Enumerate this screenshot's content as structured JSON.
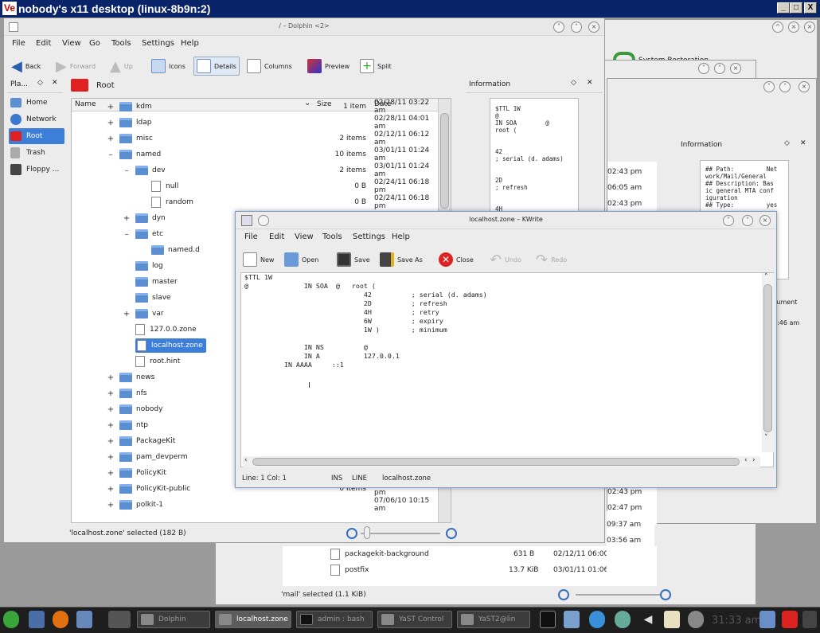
{
  "vnc": {
    "logo": "Ve",
    "title": "nobody's x11 desktop (linux-8b9n:2)",
    "min": "_",
    "max": "□",
    "close": "X"
  },
  "dolphin": {
    "title": "/ – Dolphin <2>",
    "menu": [
      "File",
      "Edit",
      "View",
      "Go",
      "Tools",
      "Settings",
      "Help"
    ],
    "toolbar": {
      "back": "Back",
      "forward": "Forward",
      "up": "Up",
      "icons": "Icons",
      "details": "Details",
      "columns": "Columns",
      "preview": "Preview",
      "split": "Split"
    },
    "places": {
      "title": "Pla...",
      "items": [
        "Home",
        "Network",
        "Root",
        "Trash",
        "Floppy ..."
      ]
    },
    "location": "Root",
    "columns": {
      "name": "Name",
      "size": "Size",
      "date": "Date"
    },
    "rows": [
      {
        "name": "kdm",
        "size": "1 item",
        "date": "02/28/11 03:22 am"
      },
      {
        "name": "ldap",
        "size": "",
        "date": "02/28/11 04:01 am"
      },
      {
        "name": "misc",
        "size": "2 items",
        "date": "02/12/11 06:12 am"
      },
      {
        "name": "named",
        "size": "10 items",
        "date": "03/01/11 01:24 am"
      },
      {
        "name": "dev",
        "size": "2 items",
        "date": "03/01/11 01:24 am"
      },
      {
        "name": "null",
        "size": "0 B",
        "date": "02/24/11 06:18 pm"
      },
      {
        "name": "random",
        "size": "0 B",
        "date": "02/24/11 06:18 pm"
      },
      {
        "name": "dyn",
        "size": "",
        "date": ""
      },
      {
        "name": "etc",
        "size": "",
        "date": ""
      },
      {
        "name": "named.d",
        "size": "",
        "date": ""
      },
      {
        "name": "log",
        "size": "",
        "date": ""
      },
      {
        "name": "master",
        "size": "",
        "date": ""
      },
      {
        "name": "slave",
        "size": "",
        "date": ""
      },
      {
        "name": "var",
        "size": "",
        "date": ""
      },
      {
        "name": "127.0.0.zone",
        "size": "",
        "date": ""
      },
      {
        "name": "localhost.zone",
        "size": "",
        "date": ""
      },
      {
        "name": "root.hint",
        "size": "",
        "date": ""
      },
      {
        "name": "news",
        "size": "",
        "date": ""
      },
      {
        "name": "nfs",
        "size": "",
        "date": ""
      },
      {
        "name": "nobody",
        "size": "",
        "date": ""
      },
      {
        "name": "ntp",
        "size": "",
        "date": ""
      },
      {
        "name": "PackageKit",
        "size": "",
        "date": ""
      },
      {
        "name": "pam_devperm",
        "size": "",
        "date": ""
      },
      {
        "name": "PolicyKit",
        "size": "",
        "date": ""
      },
      {
        "name": "PolicyKit-public",
        "size": "0 items",
        "date": "07/05/10 05:17 pm"
      },
      {
        "name": "polkit-1",
        "size": "",
        "date": "07/06/10 10:15 am"
      }
    ],
    "status": "'localhost.zone' selected (182 B)",
    "info": {
      "title": "Information",
      "text": "$TTL 1W\n@\nIN SOA        @\nroot (\n\n\n42\n; serial (d. adams)\n\n\n2D\n; refresh\n\n\n4H"
    }
  },
  "dolphin2": {
    "info_title": "Information",
    "info_text": "## Path:         Net\nwork/Mail/General\n## Description: Bas\nic general MTA conf\niguration\n## Type:         yes",
    "times": [
      "02:43 pm",
      "06:05 am",
      "02:43 pm"
    ],
    "right_frag": [
      "cument",
      "3:46 am"
    ],
    "lower_times": [
      "02:43 pm",
      "02:47 pm",
      "09:37 am",
      "03:56 am"
    ],
    "rows": [
      {
        "name": "packagekit-background",
        "size": "631 B",
        "date": "02/12/11 06:00 am"
      },
      {
        "name": "postfix",
        "size": "13.7 KiB",
        "date": "03/01/11 01:06 am"
      }
    ],
    "status": "'mail' selected (1.1 KiB)",
    "sysrest": "System Restoration"
  },
  "kwrite": {
    "title": "localhost.zone – KWrite",
    "menu": [
      "File",
      "Edit",
      "View",
      "Tools",
      "Settings",
      "Help"
    ],
    "toolbar": {
      "new": "New",
      "open": "Open",
      "save": "Save",
      "saveas": "Save As",
      "close": "Close",
      "undo": "Undo",
      "redo": "Redo"
    },
    "content": "$TTL 1W\n@              IN SOA  @   root (\n                              42          ; serial (d. adams)\n                              2D          ; refresh\n                              4H          ; retry\n                              6W          ; expiry\n                              1W )        ; minimum\n\n               IN NS          @\n               IN A           127.0.0.1\n          IN AAAA     ::1",
    "status": {
      "pos": "Line: 1 Col: 1",
      "ins": "INS",
      "mode": "LINE",
      "file": "localhost.zone"
    }
  },
  "taskbar": {
    "tasks": [
      "Dolphin",
      "localhost.zone",
      "admin : bash",
      "YaST Control",
      "YaST2@lin"
    ],
    "clock": "31:33 am"
  }
}
